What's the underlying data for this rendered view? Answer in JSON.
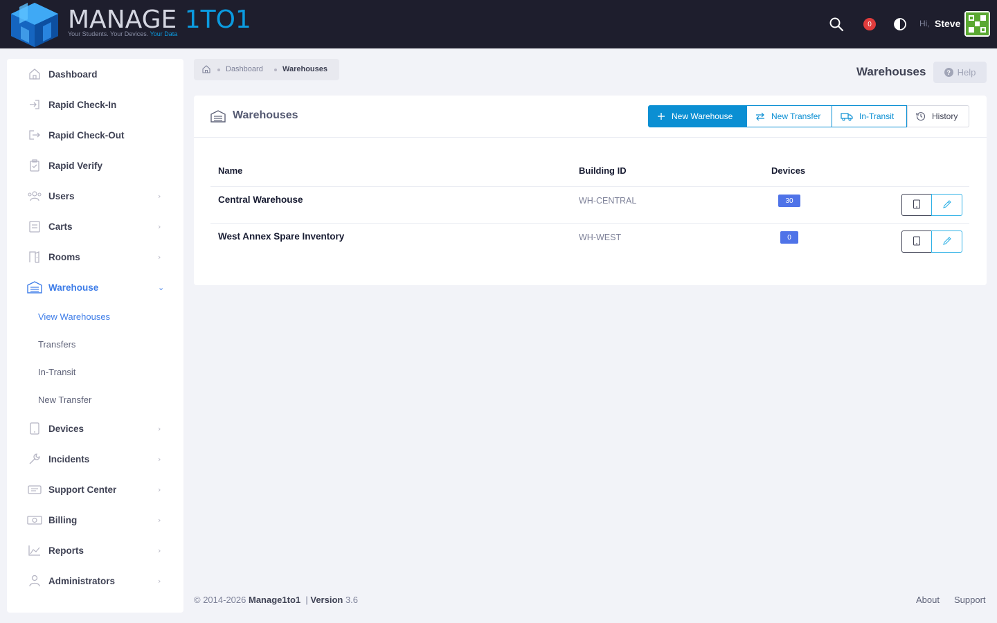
{
  "header": {
    "logo_word1": "MANAGE ",
    "logo_word2": "1TO1",
    "tagline": "Your Students. Your Devices. ",
    "tagline_highlight": "Your Data",
    "notification_count": "0",
    "greeting": "Hi,",
    "user_name": "Steve",
    "icons": [
      "search-icon",
      "notification-icon",
      "theme-toggle-icon",
      "avatar"
    ]
  },
  "sidebar": {
    "items": [
      {
        "label": "Dashboard",
        "icon": "home-icon",
        "has_children": false
      },
      {
        "label": "Rapid Check-In",
        "icon": "sign-in-icon",
        "has_children": false
      },
      {
        "label": "Rapid Check-Out",
        "icon": "sign-out-icon",
        "has_children": false
      },
      {
        "label": "Rapid Verify",
        "icon": "clipboard-check-icon",
        "has_children": false
      },
      {
        "label": "Users",
        "icon": "users-icon",
        "has_children": true
      },
      {
        "label": "Carts",
        "icon": "cart-icon",
        "has_children": true
      },
      {
        "label": "Rooms",
        "icon": "door-icon",
        "has_children": true
      },
      {
        "label": "Warehouse",
        "icon": "warehouse-icon",
        "has_children": true,
        "expanded": true
      },
      {
        "label": "Devices",
        "icon": "tablet-icon",
        "has_children": true
      },
      {
        "label": "Incidents",
        "icon": "wrench-icon",
        "has_children": true
      },
      {
        "label": "Support Center",
        "icon": "support-icon",
        "has_children": true
      },
      {
        "label": "Billing",
        "icon": "money-icon",
        "has_children": true
      },
      {
        "label": "Reports",
        "icon": "chart-icon",
        "has_children": true
      },
      {
        "label": "Administrators",
        "icon": "admin-icon",
        "has_children": true
      }
    ],
    "warehouse_sub": [
      "View Warehouses",
      "Transfers",
      "In-Transit",
      "New Transfer"
    ],
    "active_sub": "View Warehouses"
  },
  "breadcrumb": [
    "Dashboard",
    "Warehouses"
  ],
  "page_title": "Warehouses",
  "help_label": "Help",
  "card": {
    "title": "Warehouses",
    "buttons": {
      "new_warehouse": "New Warehouse",
      "new_transfer": "New Transfer",
      "in_transit": "In-Transit",
      "history": "History"
    },
    "columns": [
      "Name",
      "Building ID",
      "Devices"
    ],
    "rows": [
      {
        "name": "Central Warehouse",
        "building_id": "WH-CENTRAL",
        "devices": "30"
      },
      {
        "name": "West Annex Spare Inventory",
        "building_id": "WH-WEST",
        "devices": "0"
      }
    ]
  },
  "footer": {
    "copyright": "© 2014-2026 ",
    "brand": "Manage1to1",
    "version_label": "Version",
    "version": "3.6",
    "links": [
      "About",
      "Support"
    ]
  },
  "colors": {
    "header_bg": "#1e1e2d",
    "accent": "#0b8fd3",
    "active_nav": "#3e7de8",
    "badge": "#4f73e8",
    "notification": "#e03c3c"
  }
}
